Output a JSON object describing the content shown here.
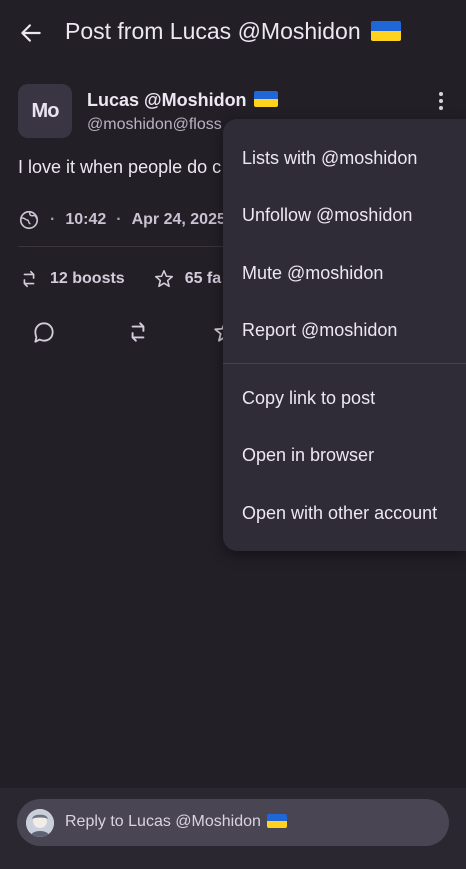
{
  "topbar": {
    "title": "Post from Lucas @Moshidon",
    "back_icon": "arrow-left-icon"
  },
  "post": {
    "avatar_text": "Mo",
    "author_name": "Lucas @Moshidon",
    "author_handle": "@moshidon@floss",
    "body": "I love it when people do c",
    "visibility_icon": "globe-icon",
    "time": "10:42",
    "date": "Apr 24, 2025",
    "boosts": "12 boosts",
    "favorites": "65 fa"
  },
  "menu": {
    "items": [
      "Lists with @moshidon",
      "Unfollow @moshidon",
      "Mute @moshidon",
      "Report @moshidon",
      "Copy link to post",
      "Open in browser",
      "Open with other account"
    ]
  },
  "reply": {
    "placeholder": "Reply to Lucas @Moshidon"
  },
  "colors": {
    "background": "#231f27",
    "menu_background": "#302c37",
    "reply_field": "#4a4553",
    "flag_blue": "#1f66d6",
    "flag_yellow": "#ffd21e"
  }
}
